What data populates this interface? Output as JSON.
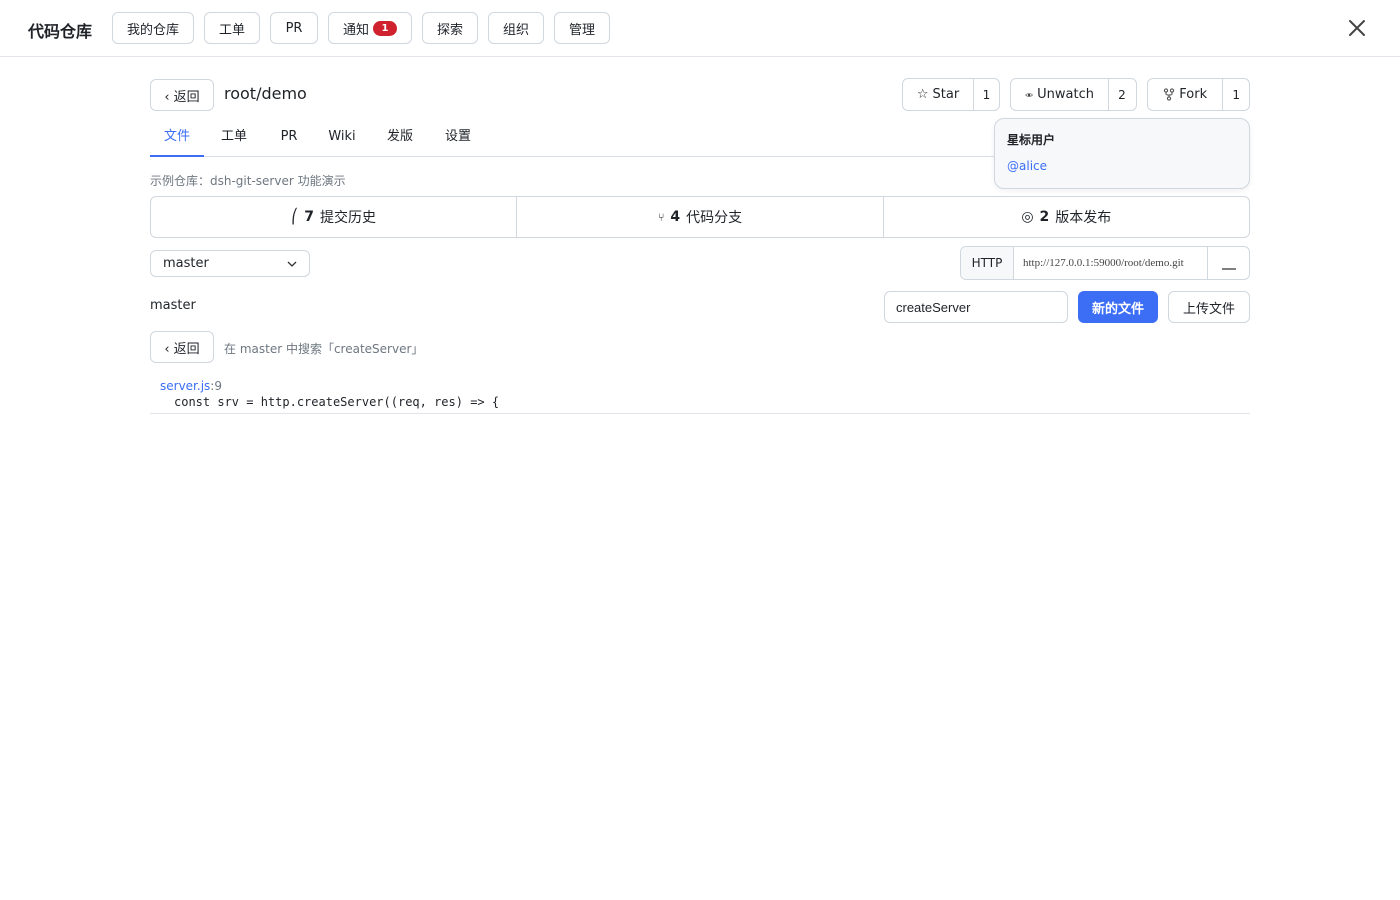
{
  "topbar": {
    "brand": "代码仓库",
    "nav": [
      {
        "label": "我的仓库"
      },
      {
        "label": "工单"
      },
      {
        "label": "PR"
      },
      {
        "label": "通知",
        "badge": "1"
      },
      {
        "label": "探索"
      },
      {
        "label": "组织"
      },
      {
        "label": "管理"
      }
    ],
    "close_icon": "close-icon"
  },
  "repo": {
    "back_label": "‹ 返回",
    "name": "root/demo",
    "star": {
      "label": "Star",
      "count": "1",
      "icon": "star-icon"
    },
    "watch": {
      "label": "Unwatch",
      "count": "2",
      "icon": "eye-icon"
    },
    "fork": {
      "label": "Fork",
      "count": "1",
      "icon": "fork-icon"
    }
  },
  "tabs": [
    {
      "label": "文件",
      "active": true
    },
    {
      "label": "工单"
    },
    {
      "label": "PR"
    },
    {
      "label": "Wiki"
    },
    {
      "label": "发版"
    },
    {
      "label": "设置"
    }
  ],
  "description": "示例仓库：dsh-git-server 功能演示",
  "stats": [
    {
      "icon": "commit-icon",
      "glyph": "⎛",
      "count": "7",
      "label": "提交历史"
    },
    {
      "icon": "branch-icon",
      "glyph": "⑂",
      "count": "4",
      "label": "代码分支"
    },
    {
      "icon": "tag-icon",
      "glyph": "◎",
      "count": "2",
      "label": "版本发布"
    }
  ],
  "branch": {
    "selected": "master",
    "label": "master"
  },
  "clone": {
    "protocol": "HTTP",
    "url": "http://127.0.0.1:59000/root/demo.git",
    "copy_icon": "copy-icon"
  },
  "search": {
    "value": "createServer",
    "new_file_label": "新的文件",
    "upload_label": "上传文件",
    "back_label": "‹ 返回",
    "summary": "在 master 中搜索「createServer」"
  },
  "results": [
    {
      "file": "server.js",
      "line": ":9",
      "code": "const srv = http.createServer((req, res) => {"
    }
  ],
  "popover": {
    "title": "星标用户",
    "users": [
      "@alice"
    ]
  },
  "colors": {
    "accent": "#3b6ef5",
    "badge": "#cf222e",
    "border": "#d0d7de"
  }
}
